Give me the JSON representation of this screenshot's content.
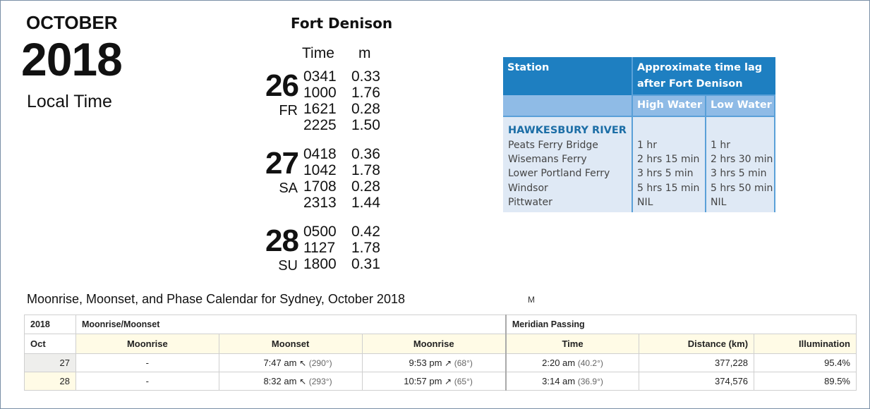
{
  "header": {
    "month": "OCTOBER",
    "year": "2018",
    "subtitle": "Local Time"
  },
  "tides": {
    "station": "Fort Denison",
    "col_time": "Time",
    "col_m": "m",
    "days": [
      {
        "day": "26",
        "abbr": "FR",
        "entries": [
          [
            "0341",
            "0.33"
          ],
          [
            "1000",
            "1.76"
          ],
          [
            "1621",
            "0.28"
          ],
          [
            "2225",
            "1.50"
          ]
        ]
      },
      {
        "day": "27",
        "abbr": "SA",
        "entries": [
          [
            "0418",
            "0.36"
          ],
          [
            "1042",
            "1.78"
          ],
          [
            "1708",
            "0.28"
          ],
          [
            "2313",
            "1.44"
          ]
        ]
      },
      {
        "day": "28",
        "abbr": "SU",
        "entries": [
          [
            "0500",
            "0.42"
          ],
          [
            "1127",
            "1.78"
          ],
          [
            "1800",
            "0.31"
          ]
        ]
      }
    ]
  },
  "lag_table": {
    "h_station": "Station",
    "h_lag_1": "Approximate time lag",
    "h_lag_2": "after Fort Denison",
    "h_high": "High Water",
    "h_low": "Low Water",
    "section": "HAWKESBURY RIVER",
    "rows": [
      {
        "name": "Peats Ferry Bridge",
        "high": "1 hr",
        "low": "1 hr"
      },
      {
        "name": "Wisemans Ferry",
        "high": "2 hrs 15 min",
        "low": "2 hrs 30 min"
      },
      {
        "name": "Lower Portland Ferry",
        "high": "3 hrs 5 min",
        "low": "3 hrs 5 min"
      },
      {
        "name": "Windsor",
        "high": "5 hrs 15 min",
        "low": "5 hrs 50 min"
      },
      {
        "name": "Pittwater",
        "high": "NIL",
        "low": "NIL"
      }
    ]
  },
  "moon": {
    "title": "Moonrise, Moonset, and Phase Calendar for Sydney, October 2018",
    "stray": "M",
    "h_year": "2018",
    "h_group": "Moonrise/Moonset",
    "h_meridian": "Meridian Passing",
    "cols": [
      "Oct",
      "Moonrise",
      "Moonset",
      "Moonrise",
      "Time",
      "Distance (km)",
      "Illumination"
    ],
    "set_arrow": "↖",
    "rise_arrow": "↗",
    "rows": [
      {
        "day": "27",
        "rise1": "-",
        "set": "7:47 am",
        "set_deg": "(290°)",
        "rise2": "9:53 pm",
        "rise2_deg": "(68°)",
        "mer": "2:20 am",
        "mer_deg": "(40.2°)",
        "dist": "377,228",
        "illum": "95.4%"
      },
      {
        "day": "28",
        "rise1": "-",
        "set": "8:32 am",
        "set_deg": "(293°)",
        "rise2": "10:57 pm",
        "rise2_deg": "(65°)",
        "mer": "3:14 am",
        "mer_deg": "(36.9°)",
        "dist": "374,576",
        "illum": "89.5%"
      }
    ]
  },
  "colors": {
    "lag_header": "#1e7fc1",
    "lag_subheader": "#8fbbe6",
    "lag_body": "#dfe9f5",
    "section_text": "#1c6ea6"
  }
}
